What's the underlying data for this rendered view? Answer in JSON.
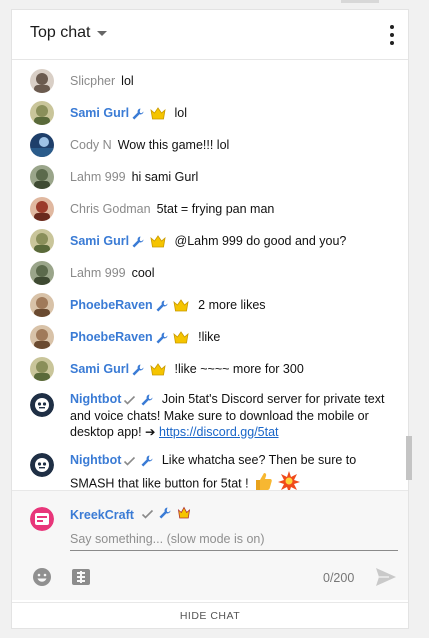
{
  "header": {
    "title": "Top chat",
    "menu_icon": "more-vert-icon"
  },
  "messages": [
    {
      "author": "Slicpher",
      "member": false,
      "text": "lol",
      "avatar_color": "#6b5b4f"
    },
    {
      "author": "Sami Gurl",
      "member": true,
      "badges": [
        "wrench-icon",
        "crown-icon"
      ],
      "text": "lol",
      "avatar_color": "#8a8f5a"
    },
    {
      "author": "Cody N",
      "member": false,
      "text": "Wow this game!!! lol",
      "avatar_color": "#2a5b8a"
    },
    {
      "author": "Lahm 999",
      "member": false,
      "text": "hi sami Gurl",
      "avatar_color": "#5b6a4c"
    },
    {
      "author": "Chris Godman",
      "member": false,
      "text": "5tat = frying pan man",
      "avatar_color": "#9b3b2b"
    },
    {
      "author": "Sami Gurl",
      "member": true,
      "badges": [
        "wrench-icon",
        "crown-icon"
      ],
      "text": "@Lahm 999 do good and you?",
      "avatar_color": "#8a8f5a"
    },
    {
      "author": "Lahm 999",
      "member": false,
      "text": "cool",
      "avatar_color": "#5b6a4c"
    },
    {
      "author": "PhoebeRaven",
      "member": true,
      "badges": [
        "wrench-icon",
        "crown-icon"
      ],
      "text": "2 more likes",
      "avatar_color": "#a07a5a"
    },
    {
      "author": "PhoebeRaven",
      "member": true,
      "badges": [
        "wrench-icon",
        "crown-icon"
      ],
      "text": "!like",
      "avatar_color": "#a07a5a"
    },
    {
      "author": "Sami Gurl",
      "member": true,
      "badges": [
        "wrench-icon",
        "crown-icon"
      ],
      "text": "!like ~~~~ more for 300",
      "avatar_color": "#8a8f5a"
    },
    {
      "author": "Nightbot",
      "member": true,
      "badges": [
        "check-icon",
        "wrench-icon"
      ],
      "text": "Join 5tat's Discord server for private text and voice chats! Make sure to download the mobile or desktop app! ➔",
      "link": "https://discord.gg/5tat",
      "avatar_color": "#1f2f45"
    },
    {
      "author": "Nightbot",
      "member": true,
      "badges": [
        "check-icon",
        "wrench-icon"
      ],
      "text": "Like whatcha see? Then be sure to SMASH that like button for 5tat !",
      "emojis": [
        "thumbs-up-emoji",
        "collision-emoji"
      ],
      "avatar_color": "#1f2f45"
    }
  ],
  "composer": {
    "user_name": "KreekCraft",
    "user_badges": [
      "check-icon",
      "wrench-icon",
      "crown-icon"
    ],
    "placeholder": "Say something... (slow mode is on)",
    "char_count": "0/200",
    "emoji_icon": "emoji-smile-icon",
    "money_icon": "super-chat-icon",
    "send_icon": "send-icon"
  },
  "footer": {
    "hide_label": "HIDE CHAT"
  },
  "colors": {
    "member_name": "#3a7bd5",
    "author_name": "#8a8a8a",
    "link": "#1a66c8",
    "crown": "#f5c400"
  }
}
